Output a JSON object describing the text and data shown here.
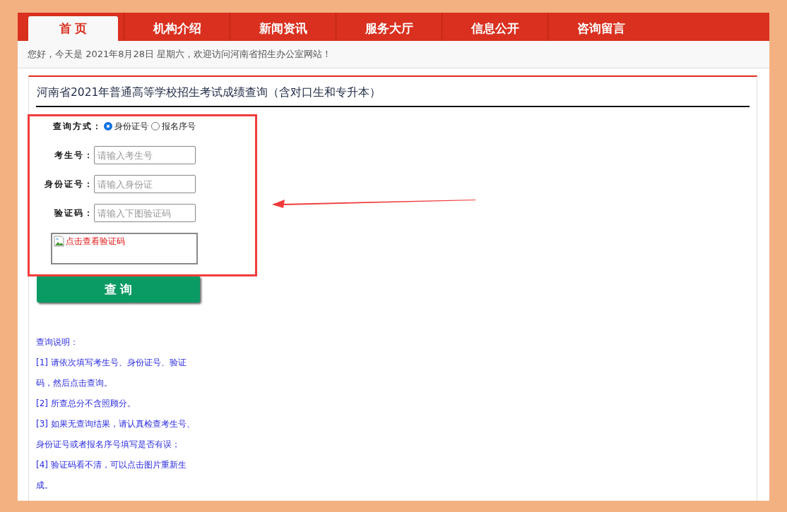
{
  "nav": {
    "tabs": [
      {
        "label": "首 页",
        "selected": true
      },
      {
        "label": "机构介绍",
        "selected": false
      },
      {
        "label": "新闻资讯",
        "selected": false
      },
      {
        "label": "服务大厅",
        "selected": false
      },
      {
        "label": "信息公开",
        "selected": false
      },
      {
        "label": "咨询留言",
        "selected": false
      }
    ]
  },
  "greeting": "您好，今天是 2021年8月28日 星期六，欢迎访问河南省招生办公室网站！",
  "panel": {
    "title": "河南省2021年普通高等学校招生考试成绩查询（含对口生和专升本）",
    "query_mode": {
      "label": "查询方式：",
      "options": [
        {
          "label": "身份证号",
          "selected": true
        },
        {
          "label": "报名序号",
          "selected": false
        }
      ]
    },
    "fields": [
      {
        "label": "考生号：",
        "placeholder": "请输入考生号"
      },
      {
        "label": "身份证号：",
        "placeholder": "请输入身份证"
      },
      {
        "label": "验证码：",
        "placeholder": "请输入下图验证码"
      }
    ],
    "captcha_alt": "点击查看验证码",
    "submit": "查 询",
    "notes": [
      "查询说明：",
      "[1] 请依次填写考生号、身份证号、验证码，然后点击查询。",
      "[2] 所查总分不含照顾分。",
      "[3] 如果无查询结果，请认真检查考生号、身份证号或者报名序号填写是否有误；",
      "[4] 验证码看不清，可以点击图片重新生成。"
    ]
  }
}
